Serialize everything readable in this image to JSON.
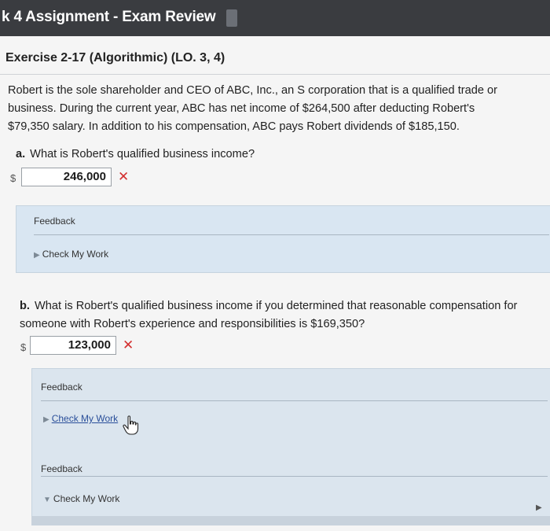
{
  "header": {
    "title": "k 4 Assignment - Exam Review"
  },
  "exercise": {
    "title": "Exercise 2-17 (Algorithmic) (LO. 3, 4)",
    "problem_line1": "Robert is the sole shareholder and CEO of ABC, Inc., an S corporation that is a qualified trade or",
    "problem_line2": "business. During the current year, ABC has net income of $264,500 after deducting Robert's",
    "problem_line3": "$79,350 salary. In addition to his compensation, ABC pays Robert dividends of $185,150."
  },
  "part_a": {
    "letter": "a.",
    "question": "What is Robert's qualified business income?",
    "currency": "$",
    "answer": "246,000",
    "status_mark": "✕",
    "feedback_label": "Feedback",
    "check_label": "Check My Work"
  },
  "part_b": {
    "letter": "b.",
    "question": "What is Robert's qualified business income if you determined that reasonable compensation for someone with Robert's experience and responsibilities is $169,350?",
    "currency": "$",
    "answer": "123,000",
    "status_mark": "✕",
    "feedback_label": "Feedback",
    "check_label": "Check My Work",
    "feedback_label_2": "Feedback",
    "check_label_2": "Check My Work"
  },
  "icons": {
    "bookmark": "bookmark-icon",
    "cursor": "hand-pointer-icon",
    "error_color": "#d32f2f"
  }
}
